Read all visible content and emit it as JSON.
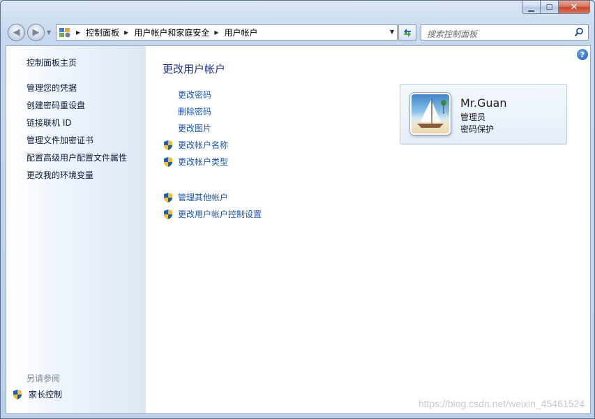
{
  "breadcrumb": [
    "控制面板",
    "用户帐户和家庭安全",
    "用户帐户"
  ],
  "search": {
    "placeholder": "搜索控制面板"
  },
  "sidebar": {
    "home": "控制面板主页",
    "links": [
      "管理您的凭据",
      "创建密码重设盘",
      "链接联机 ID",
      "管理文件加密证书",
      "配置高级用户配置文件属性",
      "更改我的环境变量"
    ],
    "see_also": "另请参阅",
    "parental": "家长控制"
  },
  "main": {
    "title": "更改用户帐户",
    "tasks": [
      {
        "label": "更改密码",
        "shield": false
      },
      {
        "label": "删除密码",
        "shield": false
      },
      {
        "label": "更改图片",
        "shield": false
      },
      {
        "label": "更改帐户名称",
        "shield": true
      },
      {
        "label": "更改帐户类型",
        "shield": true
      }
    ],
    "other_tasks": [
      {
        "label": "管理其他帐户",
        "shield": true
      },
      {
        "label": "更改用户帐户控制设置",
        "shield": true
      }
    ]
  },
  "account": {
    "name": "Mr.Guan",
    "role": "管理员",
    "status": "密码保护"
  },
  "watermark": "https://blog.csdn.net/weixin_45461524",
  "icons": {
    "back": "back-arrow-icon",
    "forward": "forward-arrow-icon",
    "refresh": "refresh-icon",
    "search": "search-icon",
    "help": "help-icon",
    "shield": "uac-shield-icon",
    "control_panel": "control-panel-icon"
  },
  "colors": {
    "link": "#1a56b4",
    "title": "#1e3287",
    "sidebar_text": "#0b1b3c"
  }
}
